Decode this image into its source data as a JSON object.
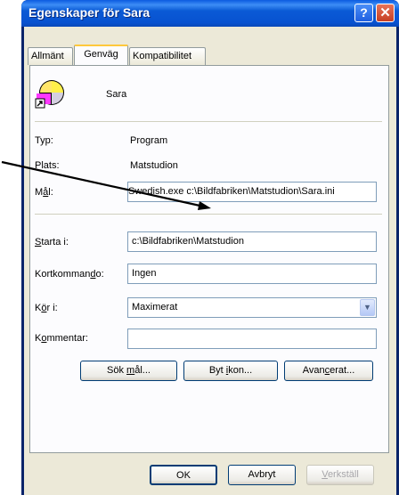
{
  "window": {
    "title": "Egenskaper för Sara"
  },
  "tabs": [
    {
      "label": "Allmänt"
    },
    {
      "label": "Genväg"
    },
    {
      "label": "Kompatibilitet"
    }
  ],
  "shortcut": {
    "name": "Sara"
  },
  "info": {
    "type_label": "Typ:",
    "type_value": "Program",
    "location_label": "Plats:",
    "location_value": "Matstudion"
  },
  "target": {
    "label": "Mål:",
    "value": "Swedish.exe c:\\Bildfabriken\\Matstudion\\Sara.ini"
  },
  "start_in": {
    "label": "Starta i:",
    "value": "c:\\Bildfabriken\\Matstudion"
  },
  "shortcut_key": {
    "label": "Kortkommando:",
    "value": "Ingen"
  },
  "run": {
    "label": "Kör i:",
    "value": "Maximerat"
  },
  "comment": {
    "label": "Kommentar:",
    "value": ""
  },
  "actions": {
    "find_target": "Sök mål...",
    "change_icon": "Byt ikon...",
    "advanced": "Avancerat..."
  },
  "footer": {
    "ok": "OK",
    "cancel": "Avbryt",
    "apply": "Verkställ"
  },
  "colors": {
    "titlebar": "#0a5ad6",
    "face": "#ece9d8",
    "tab_highlight": "#ffc83c"
  }
}
